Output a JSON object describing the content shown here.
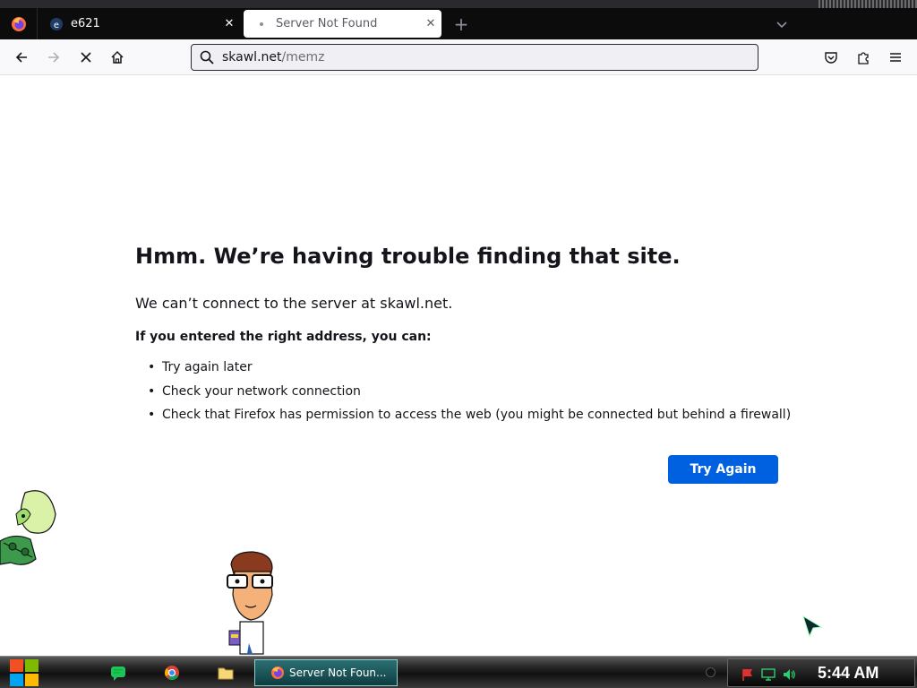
{
  "browser": {
    "tabs": [
      {
        "title": "e621",
        "favicon": "e621-favicon",
        "active": false
      },
      {
        "title": "Server Not Found",
        "favicon": "loading-dot",
        "active": true
      }
    ],
    "new_tab_symbol": "+",
    "close_symbol": "✕"
  },
  "urlbar": {
    "host": "skawl.net",
    "path": "/memz"
  },
  "error": {
    "title": "Hmm. We’re having trouble finding that site.",
    "short_desc": "We can’t connect to the server at skawl.net.",
    "hint": "If you entered the right address, you can:",
    "suggestions": [
      "Try again later",
      "Check your network connection",
      "Check that Firefox has permission to access the web (you might be connected but behind a firewall)"
    ],
    "try_again_label": "Try Again"
  },
  "taskbar": {
    "task_label": "Server Not Foun...",
    "clock": "5:44 AM"
  },
  "colors": {
    "accent": "#0061e0",
    "tabbar_bg": "#0c0c0d",
    "taskbar_task": "#1d5a5e"
  }
}
